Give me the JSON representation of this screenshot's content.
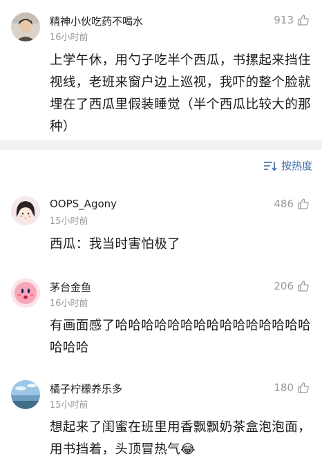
{
  "top_comment": {
    "username": "精神小伙吃药不喝水",
    "time": "16小时前",
    "likes": "913",
    "text": "上学午休，用勺子吃半个西瓜，书摞起来挡住视线，老班来窗户边上巡视，我吓的整个脸就埋在了西瓜里假装睡觉（半个西瓜比较大的那种）"
  },
  "sort": {
    "label": "按热度",
    "icon": "sort-icon"
  },
  "replies": [
    {
      "username": "OOPS_Agony",
      "time": "15小时前",
      "likes": "486",
      "text": "西瓜：我当时害怕极了"
    },
    {
      "username": "茅台金鱼",
      "time": "16小时前",
      "likes": "206",
      "text": "有画面感了哈哈哈哈哈哈哈哈哈哈哈哈哈哈哈哈哈哈"
    },
    {
      "username": "橘子柠檬养乐多",
      "time": "15小时前",
      "likes": "180",
      "text": "想起来了闺蜜在班里用香飘飘奶茶盒泡泡面，用书挡着，头顶冒热气😂"
    }
  ],
  "colors": {
    "link_blue": "#3d6aa6",
    "meta_gray": "#999999",
    "band_gray": "#f1f1f1"
  }
}
